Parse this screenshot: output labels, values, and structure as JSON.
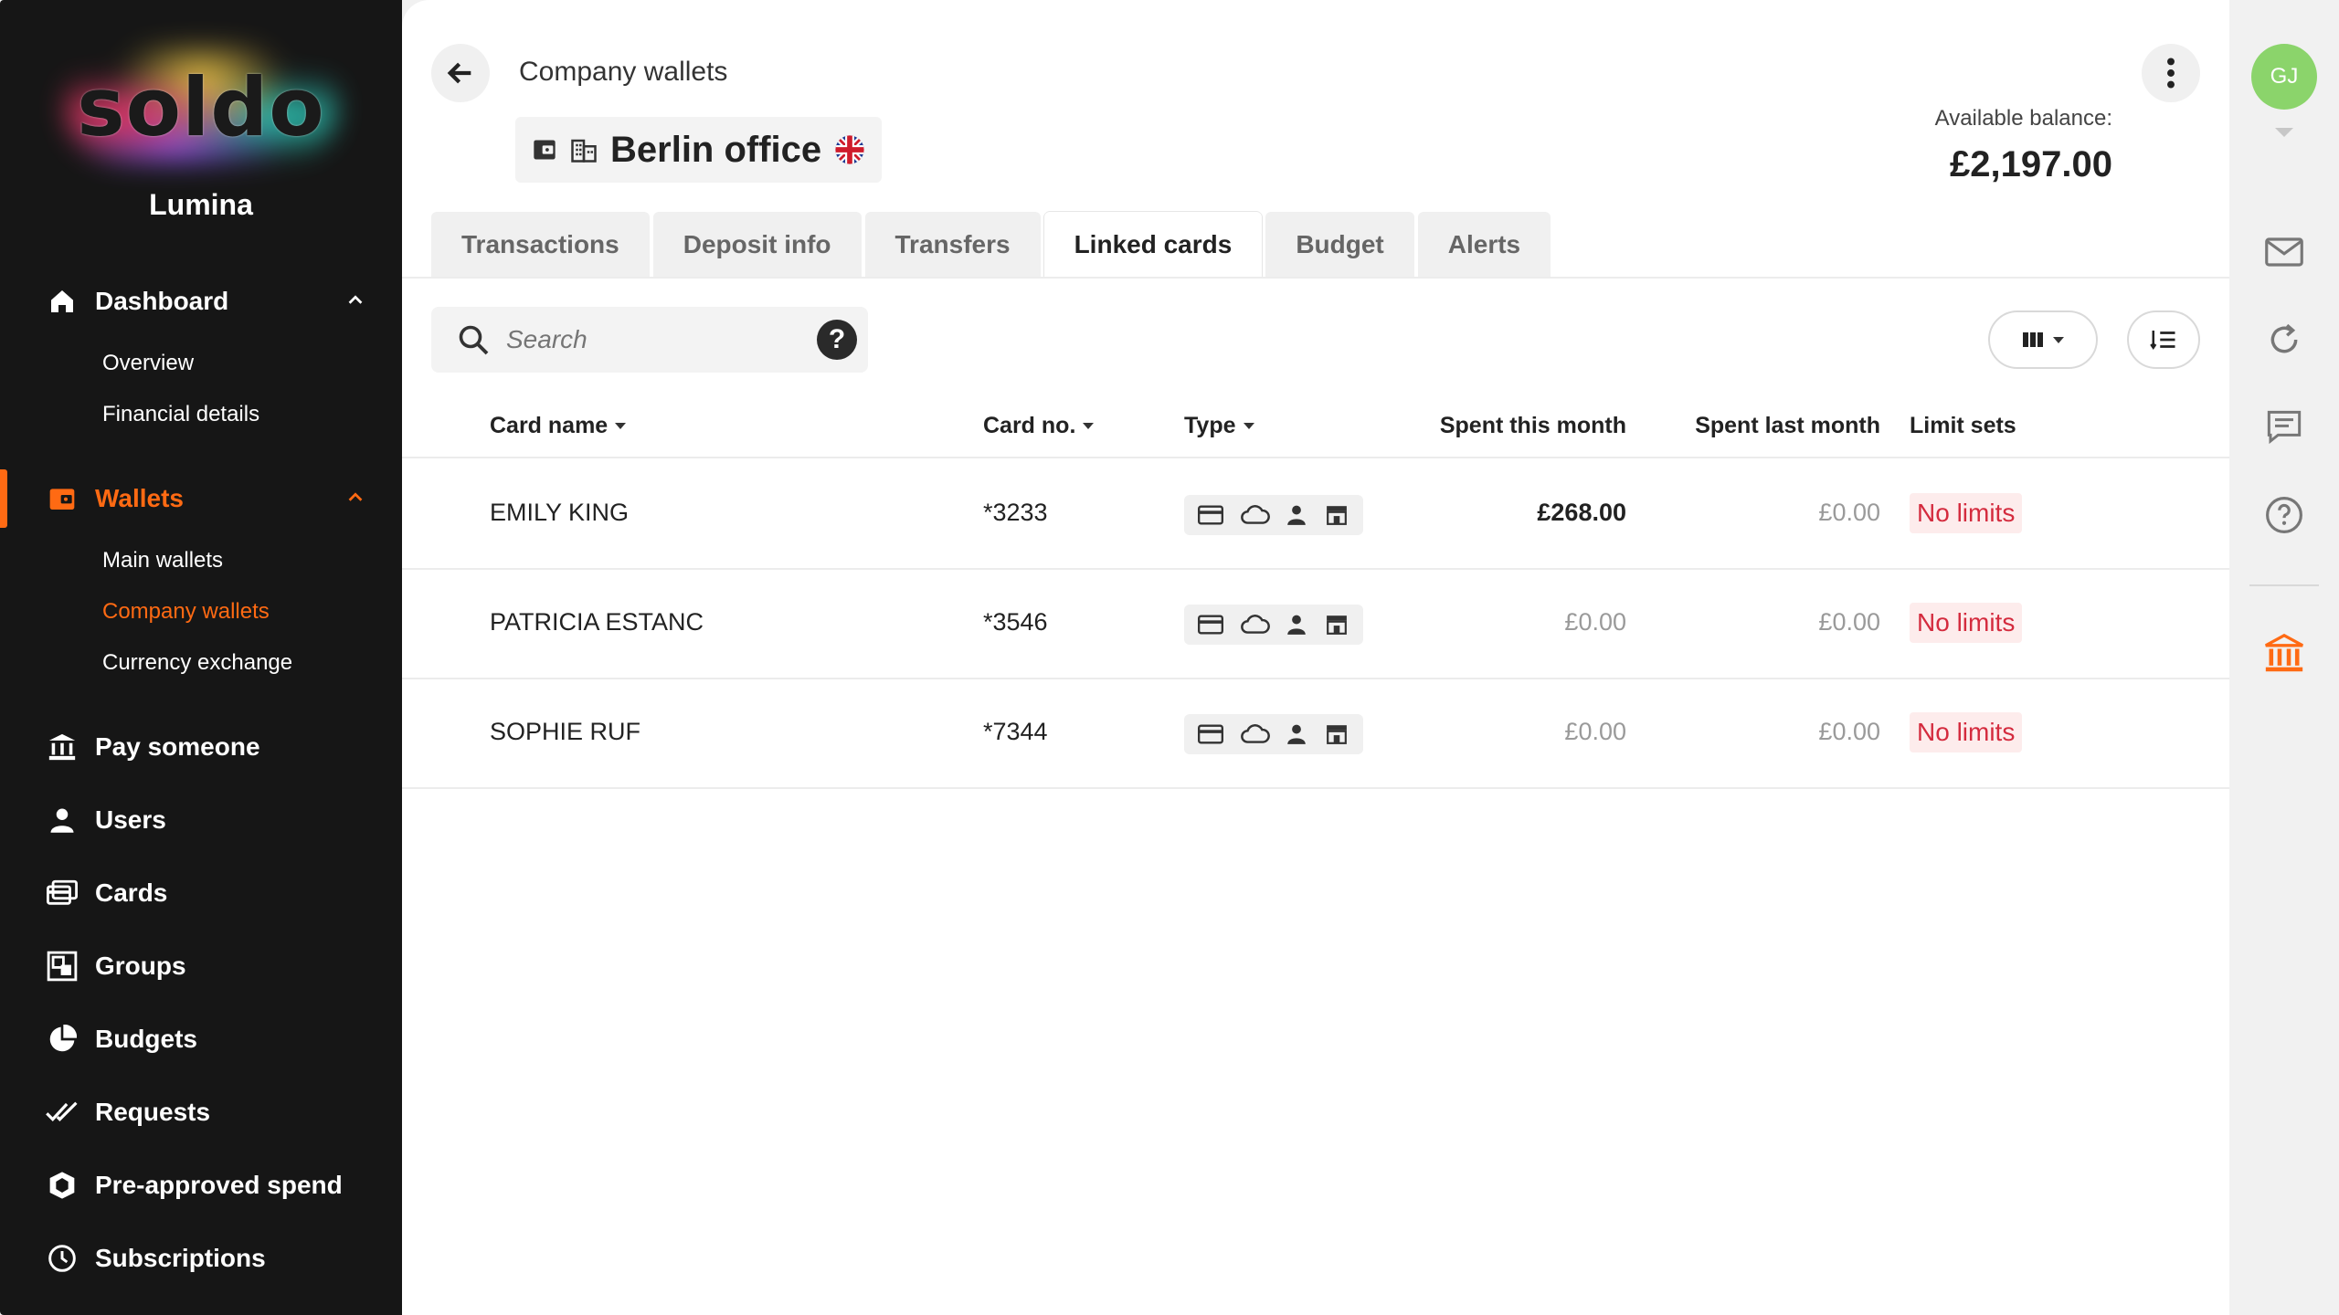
{
  "sidebar": {
    "logo_text": "soldo",
    "org_name": "Lumina",
    "dashboard": {
      "label": "Dashboard",
      "sub": [
        "Overview",
        "Financial details"
      ]
    },
    "wallets": {
      "label": "Wallets",
      "sub": [
        "Main wallets",
        "Company wallets",
        "Currency exchange"
      ],
      "active_sub": "Company wallets"
    },
    "items": [
      "Pay someone",
      "Users",
      "Cards",
      "Groups",
      "Budgets",
      "Requests",
      "Pre-approved spend",
      "Subscriptions"
    ]
  },
  "header": {
    "breadcrumb": "Company wallets",
    "wallet_name": "Berlin office",
    "balance_label": "Available balance:",
    "balance_value": "£2,197.00",
    "user_initials": "GJ"
  },
  "tabs": [
    "Transactions",
    "Deposit info",
    "Transfers",
    "Linked cards",
    "Budget",
    "Alerts"
  ],
  "active_tab": "Linked cards",
  "search": {
    "placeholder": "Search",
    "help": "?"
  },
  "table": {
    "columns": {
      "card_name": "Card name",
      "card_no": "Card no.",
      "type": "Type",
      "spent_this_month": "Spent this month",
      "spent_last_month": "Spent last month",
      "limit_sets": "Limit sets"
    },
    "rows": [
      {
        "name": "EMILY KING",
        "card_no": "*3233",
        "spent_this": "£268.00",
        "spent_last": "£0.00",
        "limit": "No limits"
      },
      {
        "name": "PATRICIA ESTANC",
        "card_no": "*3546",
        "spent_this": "£0.00",
        "spent_last": "£0.00",
        "limit": "No limits"
      },
      {
        "name": "SOPHIE RUF",
        "card_no": "*7344",
        "spent_this": "£0.00",
        "spent_last": "£0.00",
        "limit": "No limits"
      }
    ]
  },
  "colors": {
    "accent": "#ff6a13",
    "sidebar_bg": "#161616",
    "limit_text": "#d42b3e",
    "limit_bg": "#fdecec",
    "avatar": "#8bd46b"
  },
  "icons": [
    "home-icon",
    "wallet-icon",
    "bank-icon",
    "user-icon",
    "cards-icon",
    "groups-icon",
    "budget-icon",
    "requests-icon",
    "shield-icon",
    "clock-icon",
    "search-icon",
    "help-icon",
    "columns-icon",
    "sort-icon",
    "mail-icon",
    "refresh-icon",
    "chat-icon",
    "question-icon",
    "bank-icon",
    "uk-flag-icon"
  ]
}
